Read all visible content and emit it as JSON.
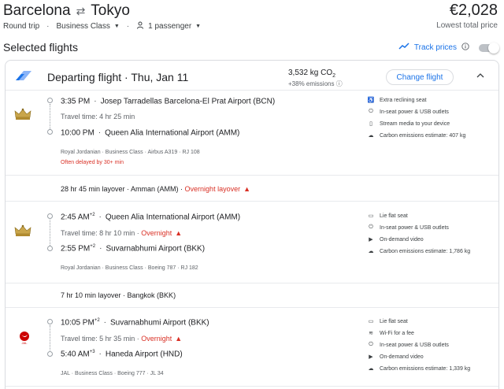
{
  "header": {
    "origin": "Barcelona",
    "destination": "Tokyo",
    "trip_type": "Round trip",
    "cabin": "Business Class",
    "passengers": "1 passenger",
    "price": "€2,028",
    "price_note": "Lowest total price"
  },
  "selected": {
    "title": "Selected flights",
    "track_label": "Track prices"
  },
  "departing": {
    "title": "Departing flight · Thu, Jan 11",
    "co2": "3,532 kg CO",
    "co2_sub": "2",
    "co2_note": "+38% emissions",
    "change_label": "Change flight"
  },
  "segments": [
    {
      "airline_icon": "crown-icon",
      "dep_time": "3:35 PM",
      "dep_sup": "",
      "dep_airport": "Josep Tarradellas Barcelona-El Prat Airport (BCN)",
      "travel": "Travel time: 4 hr 25 min",
      "overnight": "",
      "arr_time": "10:00 PM",
      "arr_sup": "",
      "arr_airport": "Queen Alia International Airport (AMM)",
      "meta": "Royal Jordanian · Business Class · Airbus A319 · RJ 108",
      "delay": "Often delayed by 30+ min",
      "amenities": [
        {
          "icon": "recline-icon",
          "label": "Extra reclining seat"
        },
        {
          "icon": "power-icon",
          "label": "In-seat power & USB outlets"
        },
        {
          "icon": "stream-icon",
          "label": "Stream media to your device"
        },
        {
          "icon": "co2-icon",
          "label": "Carbon emissions estimate: 407 kg"
        }
      ]
    },
    {
      "airline_icon": "crown-icon",
      "dep_time": "2:45 AM",
      "dep_sup": "+2",
      "dep_airport": "Queen Alia International Airport (AMM)",
      "travel": "Travel time: 8 hr 10 min",
      "overnight": "Overnight",
      "arr_time": "2:55 PM",
      "arr_sup": "+2",
      "arr_airport": "Suvarnabhumi Airport (BKK)",
      "meta": "Royal Jordanian · Business Class · Boeing 787 · RJ 182",
      "delay": "",
      "amenities": [
        {
          "icon": "flatbed-icon",
          "label": "Lie flat seat"
        },
        {
          "icon": "power-icon",
          "label": "In-seat power & USB outlets"
        },
        {
          "icon": "video-icon",
          "label": "On-demand video"
        },
        {
          "icon": "co2-icon",
          "label": "Carbon emissions estimate: 1,786 kg"
        }
      ]
    },
    {
      "airline_icon": "jal-crane-icon",
      "dep_time": "10:05 PM",
      "dep_sup": "+2",
      "dep_airport": "Suvarnabhumi Airport (BKK)",
      "travel": "Travel time: 5 hr 35 min",
      "overnight": "Overnight",
      "arr_time": "5:40 AM",
      "arr_sup": "+3",
      "arr_airport": "Haneda Airport (HND)",
      "meta": "JAL · Business Class · Boeing 777 · JL 34",
      "delay": "",
      "amenities": [
        {
          "icon": "flatbed-icon",
          "label": "Lie flat seat"
        },
        {
          "icon": "wifi-icon",
          "label": "Wi-Fi for a fee"
        },
        {
          "icon": "power-icon",
          "label": "In-seat power & USB outlets"
        },
        {
          "icon": "video-icon",
          "label": "On-demand video"
        },
        {
          "icon": "co2-icon",
          "label": "Carbon emissions estimate: 1,339 kg"
        }
      ]
    }
  ],
  "layovers": [
    {
      "text": "28 hr 45 min layover · Amman (AMM) · ",
      "note": "Overnight layover"
    },
    {
      "text": "7 hr 10 min layover · Bangkok (BKK)",
      "note": ""
    }
  ],
  "colors": {
    "accent": "#1a73e8",
    "warning": "#d93025",
    "text": "#202124"
  }
}
